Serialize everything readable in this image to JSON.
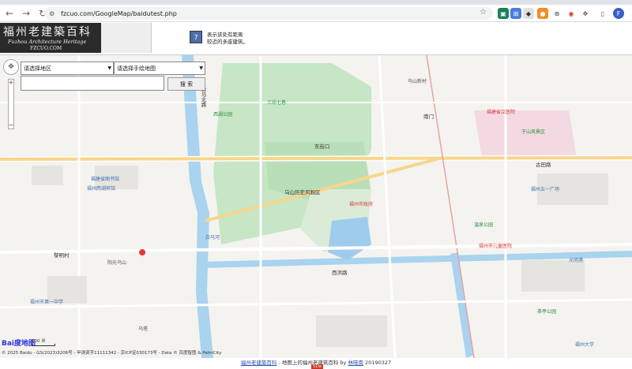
{
  "browser": {
    "url": "fzcuo.com/GoogleMap/baidutest.php",
    "profile_initial": "F"
  },
  "header": {
    "logo_cn": "福州老建築百科",
    "logo_en": "Fuzhou Architecture Heritage",
    "logo_site": "FZCUO.COM",
    "legend_line1": "表示该处有距离",
    "legend_line2": "较近的多座建筑。",
    "legend_icon": "7"
  },
  "controls": {
    "select_area": "请选择地区",
    "select_map": "请选择手绘地图",
    "search_label": "搜 索"
  },
  "map": {
    "labels": [
      {
        "text": "三坊七巷",
        "cls": "green"
      },
      {
        "text": "乌山历史风貌区",
        "cls": "bold"
      },
      {
        "text": "福州市政府",
        "cls": "red"
      },
      {
        "text": "古田路",
        "cls": "bold"
      },
      {
        "text": "白马北路",
        "cls": "bold"
      },
      {
        "text": "南门",
        "cls": "bold"
      },
      {
        "text": "黎明村",
        "cls": "bold"
      },
      {
        "text": "福建省立医院",
        "cls": "red"
      },
      {
        "text": "福州大学",
        "cls": "blue"
      },
      {
        "text": "福建省图书馆",
        "cls": "blue"
      },
      {
        "text": "乌山新村",
        "cls": ""
      },
      {
        "text": "东街口",
        "cls": "bold"
      },
      {
        "text": "福州五一广场",
        "cls": "blue"
      },
      {
        "text": "于山风景区",
        "cls": "green"
      },
      {
        "text": "乌塔",
        "cls": ""
      },
      {
        "text": "福州西湖宾馆",
        "cls": "blue"
      },
      {
        "text": "西湖公园",
        "cls": "green"
      },
      {
        "text": "温泉公园",
        "cls": "green"
      },
      {
        "text": "福州市第一中学",
        "cls": "blue"
      },
      {
        "text": "阳光乌山",
        "cls": ""
      },
      {
        "text": "白马河",
        "cls": "blue"
      },
      {
        "text": "西洪路",
        "cls": "bold"
      },
      {
        "text": "福州市儿童医院",
        "cls": "red"
      },
      {
        "text": "茶亭公园",
        "cls": "green"
      },
      {
        "text": "光明港",
        "cls": "blue"
      }
    ],
    "scale": "100 米",
    "copyright": "© 2025 Baidu - GS(2023)3206号 - 甲测资字11111342 - 京ICP证030173号 - Data © 百度智图 & PalmCity",
    "baidu_logo": "Bai度地图"
  },
  "footer": {
    "link1": "福州老建築百科",
    "middle": " - 地图上的福州老建筑百科 by ",
    "link2": "林晓南",
    "date": " 20190327",
    "badge": "51la"
  }
}
